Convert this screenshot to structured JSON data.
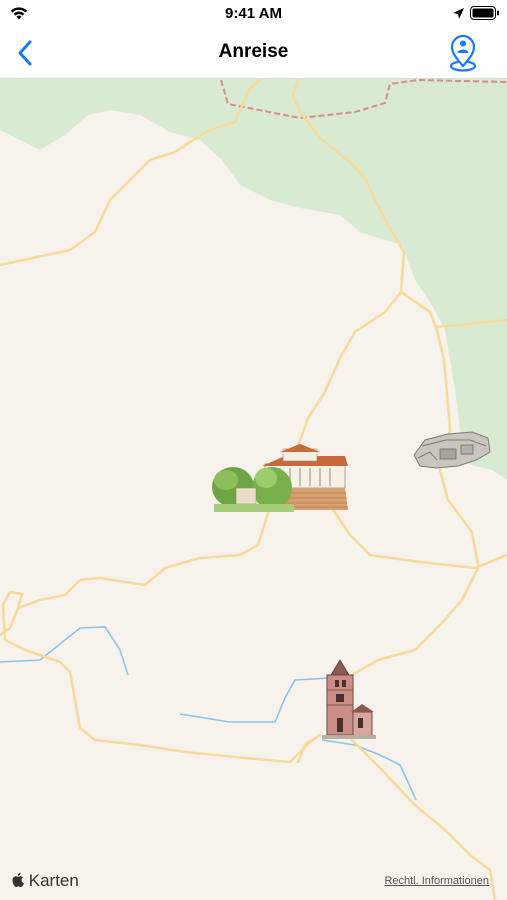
{
  "status": {
    "time": "9:41 AM"
  },
  "nav": {
    "title": "Anreise"
  },
  "map": {
    "landmarks": [
      {
        "name": "Palace with gardens"
      },
      {
        "name": "Ruin"
      },
      {
        "name": "Church tower"
      }
    ],
    "colors": {
      "land": "#f7f3ec",
      "forest": "#d9ead3",
      "road": "#f5dc9e",
      "water": "#8cc3e9",
      "border": "#d98a8a",
      "accent": "#147aff"
    }
  },
  "footer": {
    "logo_text": "Karten",
    "legal_link": "Rechtl. Informationen"
  }
}
